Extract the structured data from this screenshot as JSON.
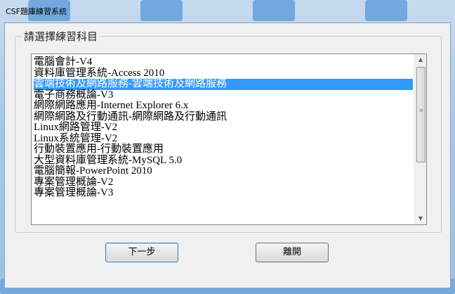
{
  "window": {
    "title": "CSF題庫練習系統"
  },
  "group": {
    "legend": "請選擇練習科目"
  },
  "subjects": [
    "電腦會計-V4",
    "資料庫管理系統-Access 2010",
    "雲端技術及網路服務-雲端技術及網路服務",
    "電子商務概論-V3",
    "網際網路應用-Internet Explorer 6.x",
    "網際網路及行動通訊-網際網路及行動通訊",
    "Linux網路管理-V2",
    "Linux系統管理-V2",
    "行動裝置應用-行動裝置應用",
    "大型資料庫管理系統-MySQL 5.0",
    "電腦簡報-PowerPoint 2010",
    "專案管理概論-V2",
    "專案管理概論-V3"
  ],
  "selected_index": 2,
  "buttons": {
    "next_label": "下一步",
    "exit_label": "離開"
  },
  "icons": {
    "scroll_up": "▲",
    "scroll_down": "▼",
    "grip": "≡"
  },
  "colors": {
    "selection": "#3399ff",
    "window_bg": "#f0f0f0",
    "frame": "#a9c7e6"
  }
}
